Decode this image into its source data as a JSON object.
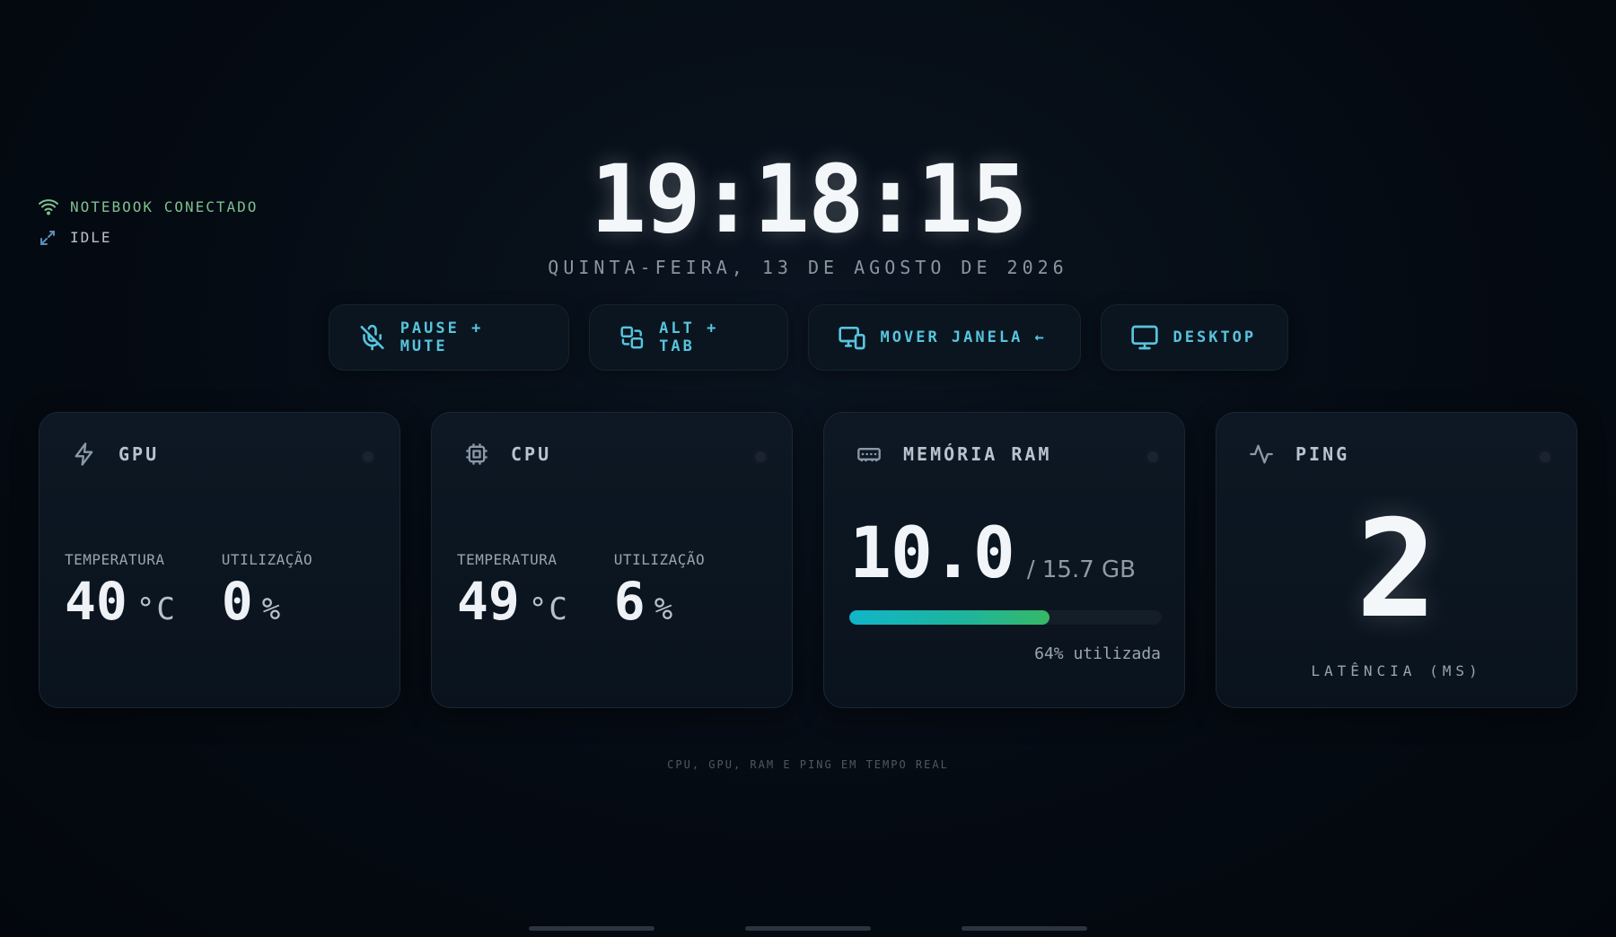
{
  "status": {
    "connection": "NOTEBOOK CONECTADO",
    "state": "IDLE",
    "connection_color": "#7fbf8f"
  },
  "clock": {
    "time": "19:18:15",
    "date": "QUINTA-FEIRA, 13 DE AGOSTO DE 2026"
  },
  "actions": [
    {
      "label": "PAUSE + MUTE",
      "icon": "mic-off-icon"
    },
    {
      "label": "ALT + TAB",
      "icon": "switch-windows-icon"
    },
    {
      "label": "MOVER JANELA ←",
      "icon": "move-window-icon"
    },
    {
      "label": "DESKTOP",
      "icon": "monitor-icon"
    }
  ],
  "cards": {
    "gpu": {
      "title": "GPU",
      "icon": "bolt-icon",
      "temp_label": "TEMPERATURA",
      "temp_value": "40",
      "temp_unit": "°C",
      "util_label": "UTILIZAÇÃO",
      "util_value": "0",
      "util_unit": "%"
    },
    "cpu": {
      "title": "CPU",
      "icon": "chip-icon",
      "temp_label": "TEMPERATURA",
      "temp_value": "49",
      "temp_unit": "°C",
      "util_label": "UTILIZAÇÃO",
      "util_value": "6",
      "util_unit": "%"
    },
    "ram": {
      "title": "MEMÓRIA RAM",
      "icon": "memory-icon",
      "used": "10.0",
      "total": "/ 15.7 GB",
      "usage_fraction": 0.64,
      "caption": "64% utilizada"
    },
    "ping": {
      "title": "PING",
      "icon": "activity-icon",
      "value": "2",
      "label": "LATÊNCIA (MS)"
    }
  },
  "footer": "CPU, GPU, RAM E PING EM TEMPO REAL",
  "colors": {
    "accent": "#58c4dc",
    "background": "#040a12",
    "card": "#0d1824"
  }
}
